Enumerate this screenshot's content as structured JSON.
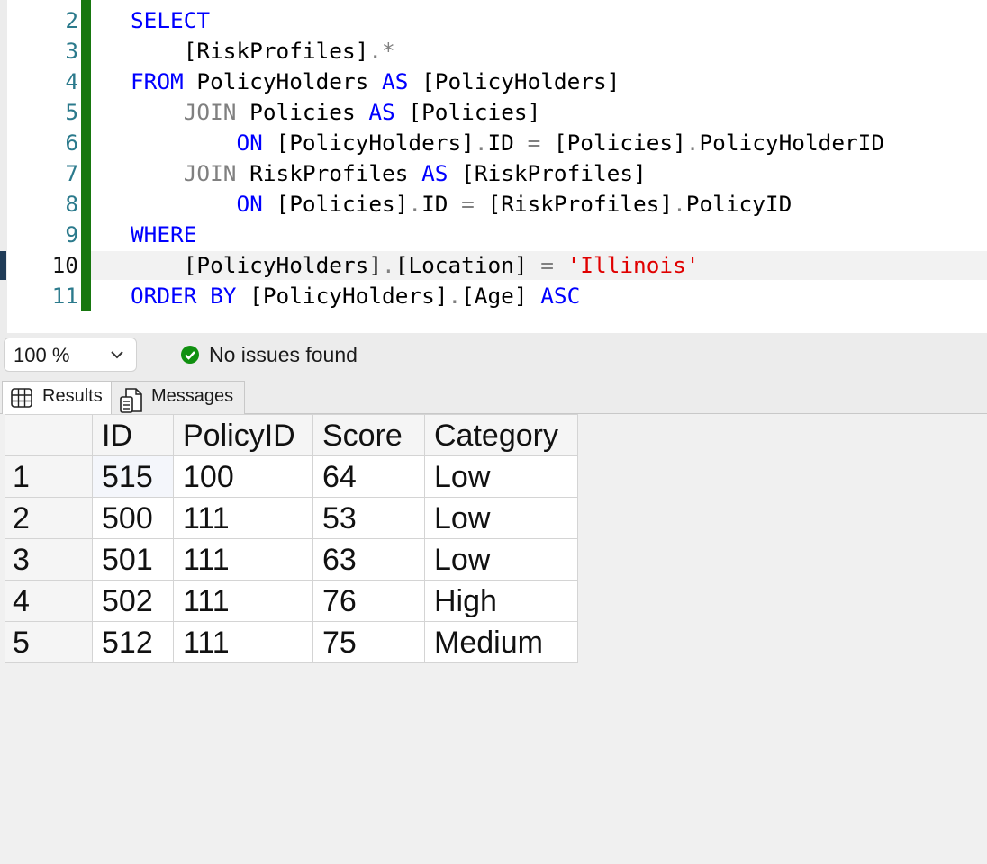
{
  "editor": {
    "current_line": 10,
    "lines": [
      {
        "num": "2",
        "tokens": [
          {
            "t": "SELECT",
            "c": "kw"
          }
        ]
      },
      {
        "num": "3",
        "tokens": [
          {
            "t": "    [RiskProfiles]",
            "c": "id"
          },
          {
            "t": ".*",
            "c": "gray"
          }
        ]
      },
      {
        "num": "4",
        "tokens": [
          {
            "t": "FROM",
            "c": "kw"
          },
          {
            "t": " PolicyHolders ",
            "c": "id"
          },
          {
            "t": "AS",
            "c": "kw"
          },
          {
            "t": " [PolicyHolders]",
            "c": "id"
          }
        ]
      },
      {
        "num": "5",
        "tokens": [
          {
            "t": "    JOIN",
            "c": "gray"
          },
          {
            "t": " Policies ",
            "c": "id"
          },
          {
            "t": "AS",
            "c": "kw"
          },
          {
            "t": " [Policies]",
            "c": "id"
          }
        ]
      },
      {
        "num": "6",
        "tokens": [
          {
            "t": "        ON",
            "c": "kw"
          },
          {
            "t": " [PolicyHolders]",
            "c": "id"
          },
          {
            "t": ".",
            "c": "gray"
          },
          {
            "t": "ID ",
            "c": "id"
          },
          {
            "t": "=",
            "c": "gray"
          },
          {
            "t": " [Policies]",
            "c": "id"
          },
          {
            "t": ".",
            "c": "gray"
          },
          {
            "t": "PolicyHolderID",
            "c": "id"
          }
        ]
      },
      {
        "num": "7",
        "tokens": [
          {
            "t": "    JOIN",
            "c": "gray"
          },
          {
            "t": " RiskProfiles ",
            "c": "id"
          },
          {
            "t": "AS",
            "c": "kw"
          },
          {
            "t": " [RiskProfiles]",
            "c": "id"
          }
        ]
      },
      {
        "num": "8",
        "tokens": [
          {
            "t": "        ON",
            "c": "kw"
          },
          {
            "t": " [Policies]",
            "c": "id"
          },
          {
            "t": ".",
            "c": "gray"
          },
          {
            "t": "ID ",
            "c": "id"
          },
          {
            "t": "=",
            "c": "gray"
          },
          {
            "t": " [RiskProfiles]",
            "c": "id"
          },
          {
            "t": ".",
            "c": "gray"
          },
          {
            "t": "PolicyID",
            "c": "id"
          }
        ]
      },
      {
        "num": "9",
        "tokens": [
          {
            "t": "WHERE",
            "c": "kw"
          }
        ]
      },
      {
        "num": "10",
        "tokens": [
          {
            "t": "    [PolicyHolders]",
            "c": "id"
          },
          {
            "t": ".",
            "c": "gray"
          },
          {
            "t": "[Location] ",
            "c": "id"
          },
          {
            "t": "=",
            "c": "gray"
          },
          {
            "t": " 'Illinois'",
            "c": "str"
          }
        ]
      },
      {
        "num": "11",
        "tokens": [
          {
            "t": "ORDER BY",
            "c": "kw"
          },
          {
            "t": " [PolicyHolders]",
            "c": "id"
          },
          {
            "t": ".",
            "c": "gray"
          },
          {
            "t": "[Age] ",
            "c": "id"
          },
          {
            "t": "ASC",
            "c": "kw"
          }
        ]
      }
    ]
  },
  "status": {
    "zoom": "100 %",
    "message": "No issues found"
  },
  "tabs": {
    "results": "Results",
    "messages": "Messages"
  },
  "grid": {
    "columns": [
      "ID",
      "PolicyID",
      "Score",
      "Category"
    ],
    "rows": [
      {
        "num": "1",
        "cells": [
          "515",
          "100",
          "64",
          "Low"
        ]
      },
      {
        "num": "2",
        "cells": [
          "500",
          "111",
          "53",
          "Low"
        ]
      },
      {
        "num": "3",
        "cells": [
          "501",
          "111",
          "63",
          "Low"
        ]
      },
      {
        "num": "4",
        "cells": [
          "502",
          "111",
          "76",
          "High"
        ]
      },
      {
        "num": "5",
        "cells": [
          "512",
          "111",
          "75",
          "Medium"
        ]
      }
    ]
  },
  "colors": {
    "keyword": "#0000ff",
    "operator": "#808080",
    "string": "#e00000",
    "line_number": "#2b7a8c",
    "change_bar": "#17770f",
    "ok_icon": "#109010"
  },
  "icons": {
    "zoom_dropdown": "chevron-down-icon",
    "status": "check-circle-icon",
    "results_tab": "grid-icon",
    "messages_tab": "document-icon"
  }
}
